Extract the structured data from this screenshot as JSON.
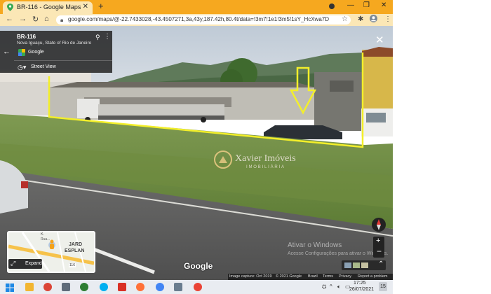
{
  "browser": {
    "tab_title": "BR-116 - Google Maps",
    "url": "google.com/maps/@-22.7433028,-43.4507271,3a,43y,187.42h,80.4t/data=!3m7!1e1!3m5!1sY_HcXwa7DKq...",
    "icons": [
      "back-arrow-icon",
      "forward-arrow-icon",
      "reload-icon",
      "lock-icon",
      "star-icon",
      "extensions-icon",
      "profile-icon",
      "kebab-menu-icon"
    ]
  },
  "infocard": {
    "place": "BR-116",
    "subtitle": "Nova Iguaçu, State of Rio de Janeiro",
    "source": "Google",
    "view_type": "Street View"
  },
  "watermark": {
    "title": "Xavier Imóveis",
    "subtitle": "IMOBILIÁRIA"
  },
  "minimap": {
    "labels": [
      "K",
      "Rua...",
      "JARD",
      "ESPLAN",
      "116"
    ],
    "expand_label": "Expand"
  },
  "windows_activation": {
    "line1": "Ativar o Windows",
    "line2": "Acesse Configurações para ativar o Windows."
  },
  "google_logo": "Google",
  "attribution": {
    "capture": "Image capture: Oct 2019",
    "copyright": "© 2021 Google",
    "country": "Brazil",
    "terms": "Terms",
    "privacy": "Privacy",
    "report": "Report a problem"
  },
  "taskbar": {
    "time": "17:25",
    "date": "26/07/2021",
    "notification_count": "15"
  },
  "colors": {
    "tabstrip": "#f6a81f",
    "outline": "#f3ef2a",
    "taskbar": "#e9ecf1"
  }
}
